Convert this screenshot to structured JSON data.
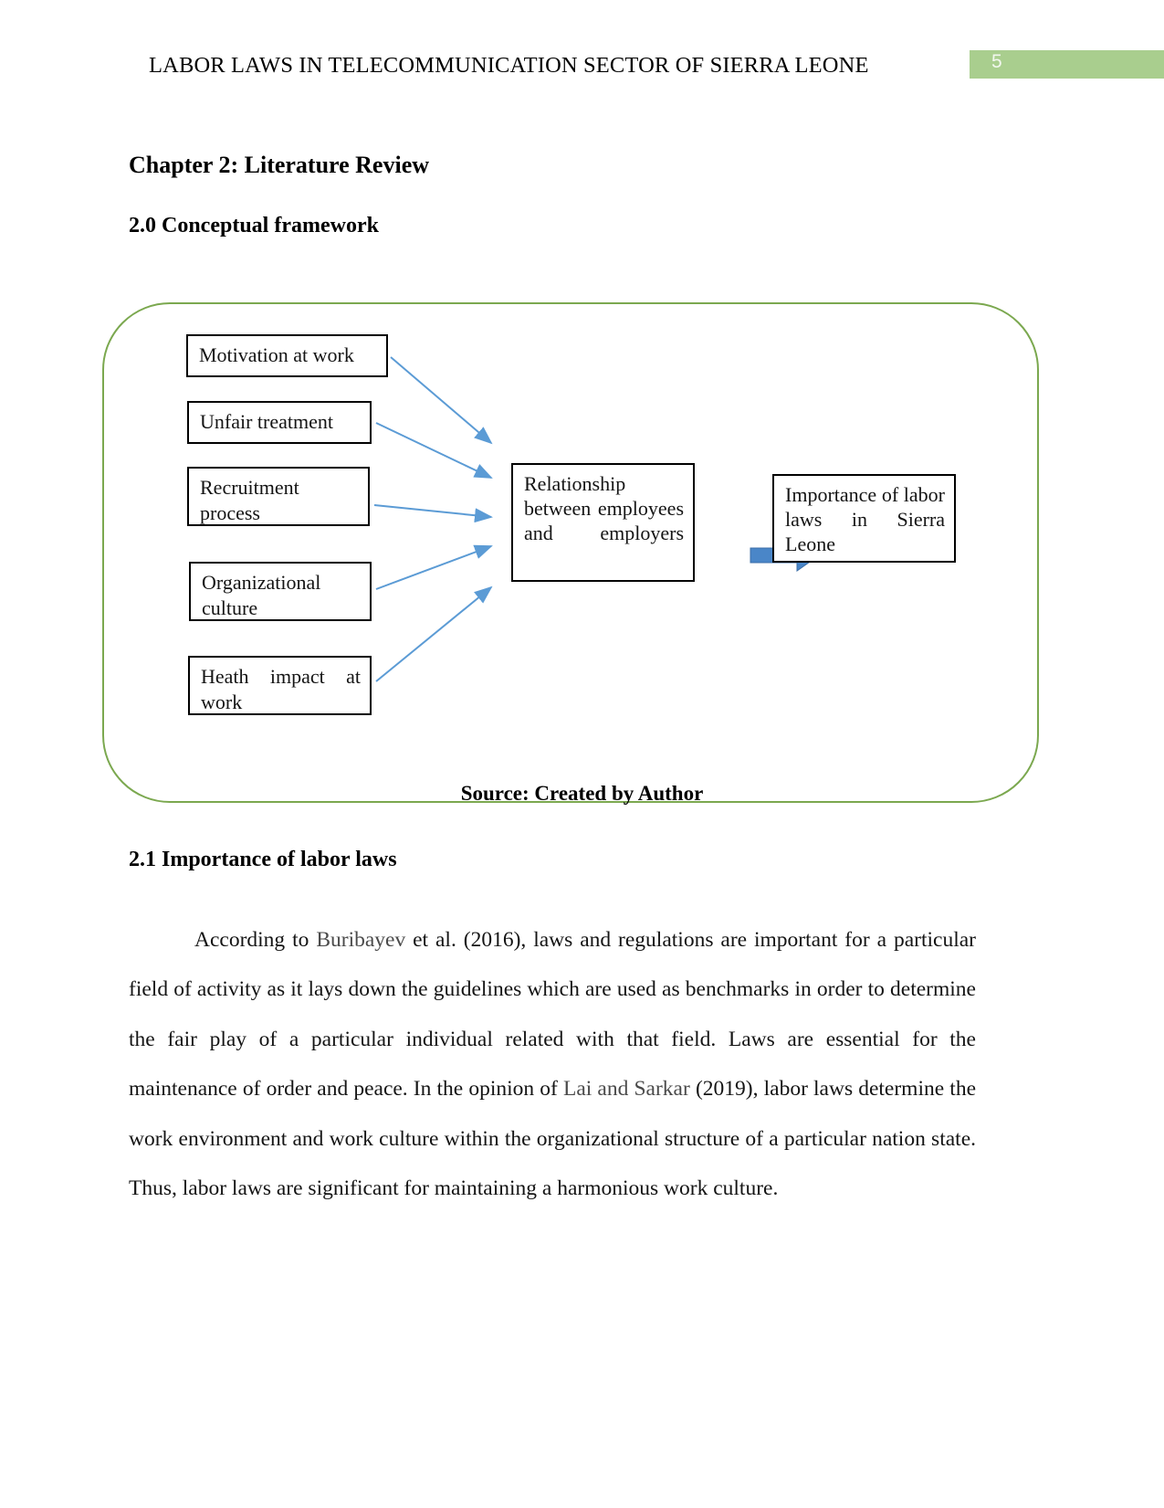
{
  "header": {
    "title": "LABOR LAWS IN TELECOMMUNICATION SECTOR OF SIERRA LEONE",
    "page_number": "5",
    "badge_color": "#A9CE8E"
  },
  "headings": {
    "chapter": "Chapter 2: Literature Review",
    "section_2_0": "2.0 Conceptual framework",
    "section_2_1": "2.1 Importance of labor laws"
  },
  "diagram": {
    "frame_border_color": "#7BA84F",
    "arrow_color": "#4A86C8",
    "inputs": [
      {
        "label": "Motivation at work"
      },
      {
        "label": "Unfair treatment"
      },
      {
        "label": "Recruitment process"
      },
      {
        "label": "Organizational culture"
      },
      {
        "label": "Heath impact at work"
      }
    ],
    "center": {
      "label": "Relationship between employees and employers"
    },
    "outcome": {
      "label": "Importance of labor laws in Sierra Leone"
    },
    "caption": "Source: Created by Author"
  },
  "paragraph": {
    "p1_part1": "According to ",
    "p1_cite1": "Buribayev",
    "p1_part2": "  et al. (2016), laws and regulations are important for a particular field of activity as it lays down the guidelines which are used as benchmarks in order to determine the fair play of a particular individual related with that field. Laws are essential for the maintenance of order and peace. In the opinion of ",
    "p1_cite2": "Lai and Sarkar",
    "p1_part3": " (2019), labor laws determine the work environment and work culture within the organizational structure of a particular nation state. Thus, labor laws are significant for maintaining a harmonious work culture."
  }
}
